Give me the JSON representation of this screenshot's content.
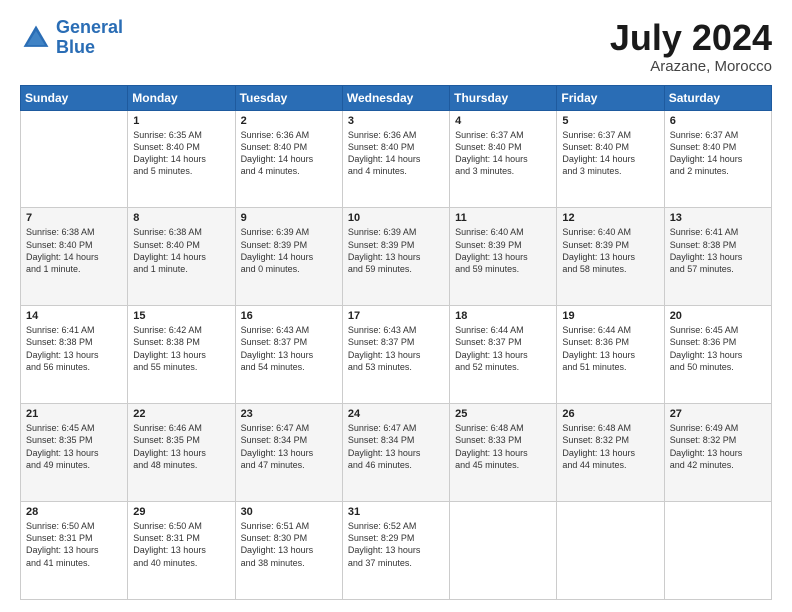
{
  "logo": {
    "line1": "General",
    "line2": "Blue"
  },
  "title": "July 2024",
  "subtitle": "Arazane, Morocco",
  "days_header": [
    "Sunday",
    "Monday",
    "Tuesday",
    "Wednesday",
    "Thursday",
    "Friday",
    "Saturday"
  ],
  "weeks": [
    [
      {
        "num": "",
        "text": ""
      },
      {
        "num": "1",
        "text": "Sunrise: 6:35 AM\nSunset: 8:40 PM\nDaylight: 14 hours\nand 5 minutes."
      },
      {
        "num": "2",
        "text": "Sunrise: 6:36 AM\nSunset: 8:40 PM\nDaylight: 14 hours\nand 4 minutes."
      },
      {
        "num": "3",
        "text": "Sunrise: 6:36 AM\nSunset: 8:40 PM\nDaylight: 14 hours\nand 4 minutes."
      },
      {
        "num": "4",
        "text": "Sunrise: 6:37 AM\nSunset: 8:40 PM\nDaylight: 14 hours\nand 3 minutes."
      },
      {
        "num": "5",
        "text": "Sunrise: 6:37 AM\nSunset: 8:40 PM\nDaylight: 14 hours\nand 3 minutes."
      },
      {
        "num": "6",
        "text": "Sunrise: 6:37 AM\nSunset: 8:40 PM\nDaylight: 14 hours\nand 2 minutes."
      }
    ],
    [
      {
        "num": "7",
        "text": "Sunrise: 6:38 AM\nSunset: 8:40 PM\nDaylight: 14 hours\nand 1 minute."
      },
      {
        "num": "8",
        "text": "Sunrise: 6:38 AM\nSunset: 8:40 PM\nDaylight: 14 hours\nand 1 minute."
      },
      {
        "num": "9",
        "text": "Sunrise: 6:39 AM\nSunset: 8:39 PM\nDaylight: 14 hours\nand 0 minutes."
      },
      {
        "num": "10",
        "text": "Sunrise: 6:39 AM\nSunset: 8:39 PM\nDaylight: 13 hours\nand 59 minutes."
      },
      {
        "num": "11",
        "text": "Sunrise: 6:40 AM\nSunset: 8:39 PM\nDaylight: 13 hours\nand 59 minutes."
      },
      {
        "num": "12",
        "text": "Sunrise: 6:40 AM\nSunset: 8:39 PM\nDaylight: 13 hours\nand 58 minutes."
      },
      {
        "num": "13",
        "text": "Sunrise: 6:41 AM\nSunset: 8:38 PM\nDaylight: 13 hours\nand 57 minutes."
      }
    ],
    [
      {
        "num": "14",
        "text": "Sunrise: 6:41 AM\nSunset: 8:38 PM\nDaylight: 13 hours\nand 56 minutes."
      },
      {
        "num": "15",
        "text": "Sunrise: 6:42 AM\nSunset: 8:38 PM\nDaylight: 13 hours\nand 55 minutes."
      },
      {
        "num": "16",
        "text": "Sunrise: 6:43 AM\nSunset: 8:37 PM\nDaylight: 13 hours\nand 54 minutes."
      },
      {
        "num": "17",
        "text": "Sunrise: 6:43 AM\nSunset: 8:37 PM\nDaylight: 13 hours\nand 53 minutes."
      },
      {
        "num": "18",
        "text": "Sunrise: 6:44 AM\nSunset: 8:37 PM\nDaylight: 13 hours\nand 52 minutes."
      },
      {
        "num": "19",
        "text": "Sunrise: 6:44 AM\nSunset: 8:36 PM\nDaylight: 13 hours\nand 51 minutes."
      },
      {
        "num": "20",
        "text": "Sunrise: 6:45 AM\nSunset: 8:36 PM\nDaylight: 13 hours\nand 50 minutes."
      }
    ],
    [
      {
        "num": "21",
        "text": "Sunrise: 6:45 AM\nSunset: 8:35 PM\nDaylight: 13 hours\nand 49 minutes."
      },
      {
        "num": "22",
        "text": "Sunrise: 6:46 AM\nSunset: 8:35 PM\nDaylight: 13 hours\nand 48 minutes."
      },
      {
        "num": "23",
        "text": "Sunrise: 6:47 AM\nSunset: 8:34 PM\nDaylight: 13 hours\nand 47 minutes."
      },
      {
        "num": "24",
        "text": "Sunrise: 6:47 AM\nSunset: 8:34 PM\nDaylight: 13 hours\nand 46 minutes."
      },
      {
        "num": "25",
        "text": "Sunrise: 6:48 AM\nSunset: 8:33 PM\nDaylight: 13 hours\nand 45 minutes."
      },
      {
        "num": "26",
        "text": "Sunrise: 6:48 AM\nSunset: 8:32 PM\nDaylight: 13 hours\nand 44 minutes."
      },
      {
        "num": "27",
        "text": "Sunrise: 6:49 AM\nSunset: 8:32 PM\nDaylight: 13 hours\nand 42 minutes."
      }
    ],
    [
      {
        "num": "28",
        "text": "Sunrise: 6:50 AM\nSunset: 8:31 PM\nDaylight: 13 hours\nand 41 minutes."
      },
      {
        "num": "29",
        "text": "Sunrise: 6:50 AM\nSunset: 8:31 PM\nDaylight: 13 hours\nand 40 minutes."
      },
      {
        "num": "30",
        "text": "Sunrise: 6:51 AM\nSunset: 8:30 PM\nDaylight: 13 hours\nand 38 minutes."
      },
      {
        "num": "31",
        "text": "Sunrise: 6:52 AM\nSunset: 8:29 PM\nDaylight: 13 hours\nand 37 minutes."
      },
      {
        "num": "",
        "text": ""
      },
      {
        "num": "",
        "text": ""
      },
      {
        "num": "",
        "text": ""
      }
    ]
  ]
}
